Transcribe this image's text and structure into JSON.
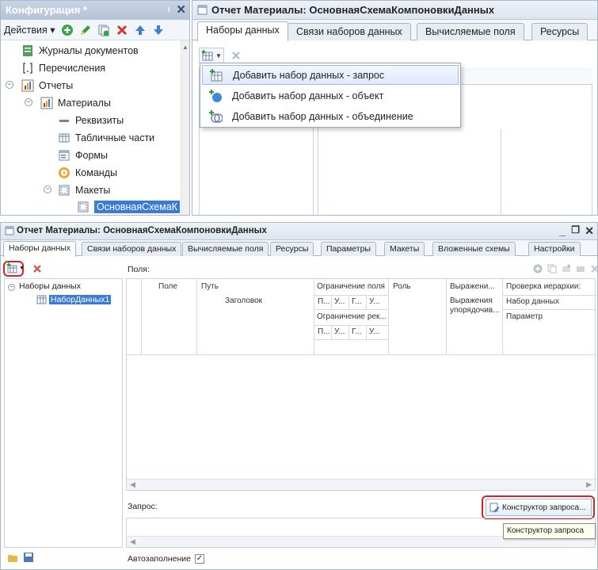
{
  "config_panel": {
    "title": "Конфигурация *",
    "actions_label": "Действия",
    "tree": [
      {
        "label": "Журналы документов"
      },
      {
        "label": "Перечисления"
      },
      {
        "label": "Отчеты"
      },
      {
        "label": "Материалы"
      },
      {
        "label": "Реквизиты"
      },
      {
        "label": "Табличные части"
      },
      {
        "label": "Формы"
      },
      {
        "label": "Команды"
      },
      {
        "label": "Макеты"
      },
      {
        "label": "ОсновнаяСхемаК"
      }
    ]
  },
  "top_editor": {
    "title": "Отчет Материалы: ОсновнаяСхемаКомпоновкиДанных",
    "tabs": [
      "Наборы данных",
      "Связи наборов данных",
      "Вычисляемые поля",
      "Ресурсы"
    ],
    "menu": [
      {
        "label": "Добавить набор данных - запрос"
      },
      {
        "label": "Добавить набор данных - объект"
      },
      {
        "label": "Добавить набор данных - объединение"
      }
    ]
  },
  "bottom_editor": {
    "title": "Отчет Материалы: ОсновнаяСхемаКомпоновкиДанных",
    "win_controls": {
      "minimize": "_",
      "restore": "❐",
      "close": "✕"
    },
    "tabs": [
      "Наборы данных",
      "Связи наборов данных",
      "Вычисляемые поля",
      "Ресурсы",
      "Параметры",
      "Макеты",
      "Вложенные схемы",
      "Настройки"
    ],
    "fields_label": "Поля:",
    "tree_root": "Наборы данных",
    "tree_child": "НаборДанных1",
    "columns": {
      "field": "Поле",
      "path": "Путь",
      "header": "Заголовок",
      "field_restriction": "Ограничение поля",
      "restr_cells": [
        "П...",
        "У...",
        "Г...",
        "У..."
      ],
      "attr_restriction": "Ограничение рек...",
      "attr_cells": [
        "П...",
        "У...",
        "Г...",
        "У..."
      ],
      "role": "Роль",
      "expression": "Выражени...",
      "order_expr": "Выражения упорядочив...",
      "hierarchy_check": "Проверка иерархии:",
      "dataset": "Набор данных",
      "parameter": "Параметр"
    },
    "query_label": "Запрос:",
    "constructor_button": "Конструктор запроса...",
    "tooltip": "Конструктор запроса",
    "autofill_label": "Автозаполнение",
    "autofill_checked": true
  }
}
